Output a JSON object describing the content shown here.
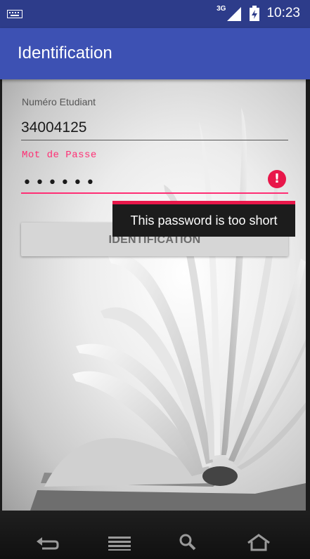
{
  "status_bar": {
    "network": "3G",
    "time": "10:23",
    "icons": [
      "keyboard-icon",
      "signal-icon",
      "battery-icon"
    ]
  },
  "app_bar": {
    "title": "Identification"
  },
  "form": {
    "student_number": {
      "label": "Numéro Etudiant",
      "value": "34004125"
    },
    "password": {
      "label": "Mot de Passe",
      "masked_value": "••••••",
      "error": "This password is too short"
    },
    "submit_label": "IDENTIFICATION"
  },
  "nav_bar": {
    "icons": [
      "back-icon",
      "menu-icon",
      "search-icon",
      "home-icon"
    ]
  },
  "colors": {
    "status_bar": "#2d3c8a",
    "app_bar": "#3d51b3",
    "accent_error": "#ff2e74",
    "error_icon": "#e8174a"
  }
}
